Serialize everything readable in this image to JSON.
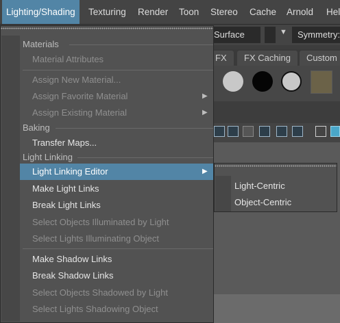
{
  "menubar": {
    "items": [
      "Lighting/Shading",
      "Texturing",
      "Render",
      "Toon",
      "Stereo",
      "Cache",
      "Arnold",
      "Help"
    ],
    "active_index": 0,
    "accent": "#5285a6"
  },
  "background": {
    "surface_field": "Surface",
    "symmetry_label": "Symmetry:",
    "shelf_tabs": [
      "FX",
      "FX Caching",
      "Custom"
    ]
  },
  "menu": {
    "sections": {
      "materials": "Materials",
      "baking": "Baking",
      "light_linking": "Light Linking"
    },
    "items": {
      "material_attributes": "Material Attributes",
      "assign_new_material": "Assign New Material...",
      "assign_favorite_material": "Assign Favorite Material",
      "assign_existing_material": "Assign Existing Material",
      "transfer_maps": "Transfer Maps...",
      "light_linking_editor": "Light Linking Editor",
      "make_light_links": "Make Light Links",
      "break_light_links": "Break Light Links",
      "select_objects_illuminated": "Select Objects Illuminated by Light",
      "select_lights_illuminating": "Select Lights Illuminating Object",
      "make_shadow_links": "Make Shadow Links",
      "break_shadow_links": "Break Shadow Links",
      "select_objects_shadowed": "Select Objects Shadowed by Light",
      "select_lights_shadowing": "Select Lights Shadowing Object"
    }
  },
  "submenu": {
    "items": [
      "Light-Centric",
      "Object-Centric"
    ]
  }
}
